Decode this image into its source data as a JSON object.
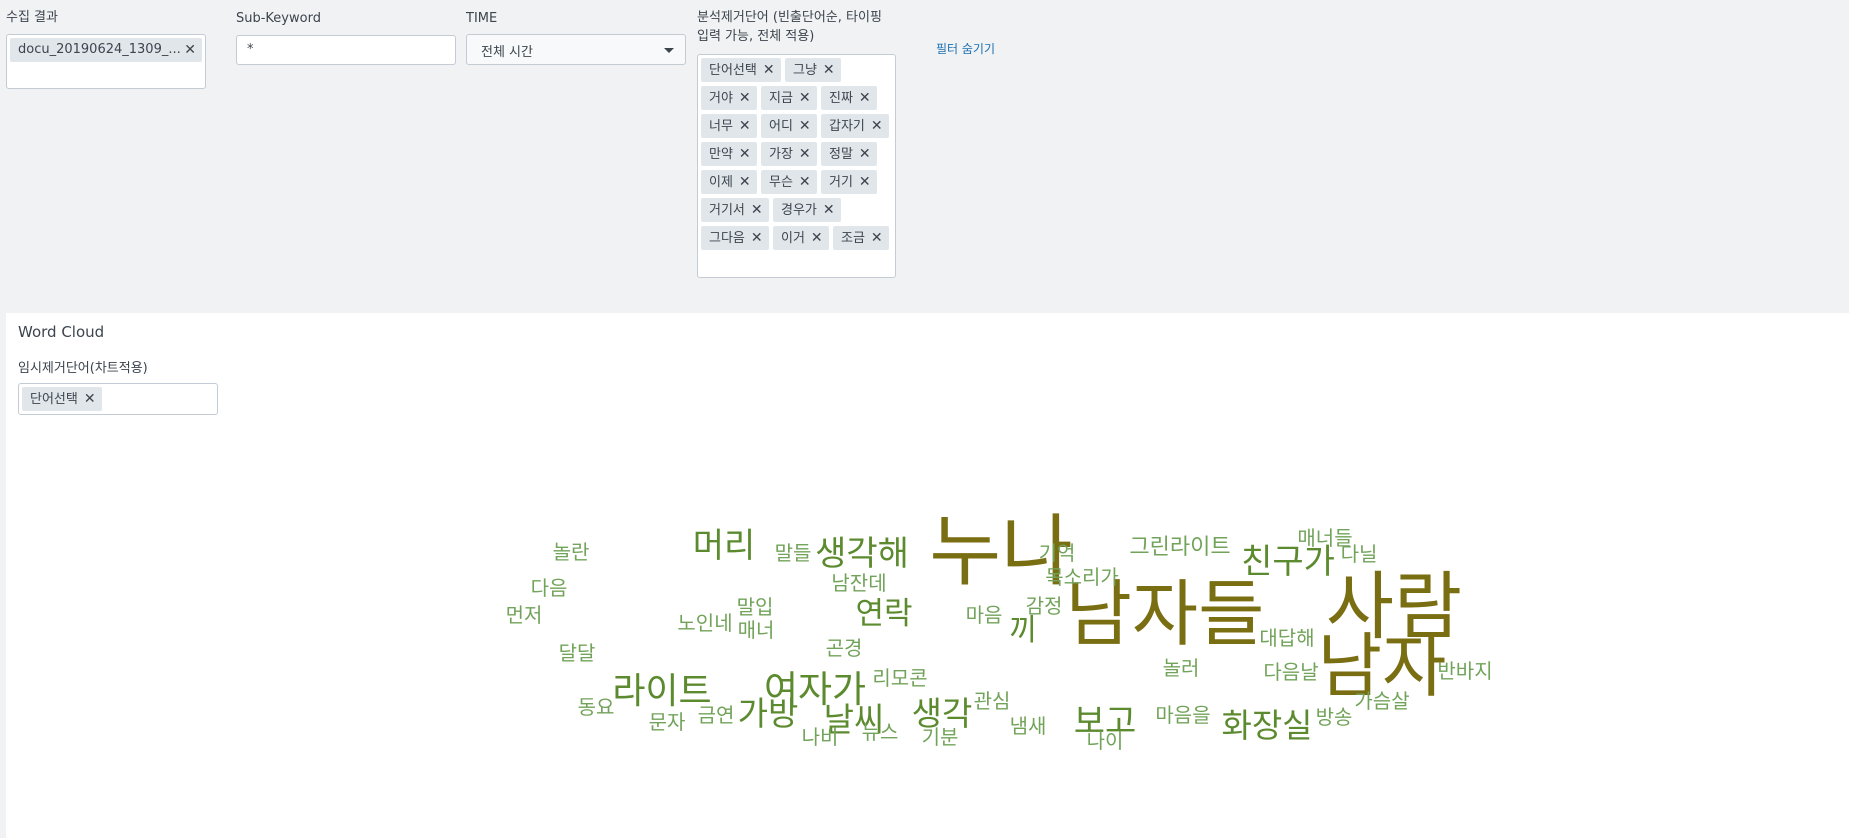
{
  "filters": {
    "collection": {
      "label": "수집 결과",
      "selected_chip": "docu_20190624_1309_..."
    },
    "subkeyword": {
      "label": "Sub-Keyword",
      "value": "*"
    },
    "time": {
      "label": "TIME",
      "value": "전체 시간"
    },
    "stopwords": {
      "label_line1": "분석제거단어 (빈출단어순, 타이핑",
      "label_line2": "입력 가능, 전체 적용)",
      "chips": [
        "단어선택",
        "그냥",
        "거야",
        "지금",
        "진짜",
        "너무",
        "어디",
        "갑자기",
        "만약",
        "가장",
        "정말",
        "이제",
        "무슨",
        "거기",
        "거기서",
        "경우가",
        "그다음",
        "이거",
        "조금"
      ]
    },
    "hide_filters_link": "필터 숨기기"
  },
  "panel": {
    "title": "Word Cloud",
    "temp_stopwords_label": "임시제거단어(차트적용)",
    "temp_chip": "단어선택"
  },
  "colors": {
    "large_word": "#7a6e12",
    "medium_word": "#5c8a2e",
    "small_word": "#72a35a"
  },
  "chart_data": {
    "type": "wordcloud",
    "words": [
      {
        "text": "누나",
        "weight": 100,
        "color": "#7a6e12"
      },
      {
        "text": "사람",
        "weight": 95,
        "color": "#7a6e12"
      },
      {
        "text": "남자들",
        "weight": 92,
        "color": "#7a6e12"
      },
      {
        "text": "남자",
        "weight": 90,
        "color": "#7a6e12"
      },
      {
        "text": "여자가",
        "weight": 48,
        "color": "#5c8a2e"
      },
      {
        "text": "라이트",
        "weight": 46,
        "color": "#5c8a2e"
      },
      {
        "text": "생각해",
        "weight": 44,
        "color": "#5c8a2e"
      },
      {
        "text": "머리",
        "weight": 44,
        "color": "#5c8a2e"
      },
      {
        "text": "친구가",
        "weight": 44,
        "color": "#5c8a2e"
      },
      {
        "text": "보고",
        "weight": 44,
        "color": "#5c8a2e"
      },
      {
        "text": "가방",
        "weight": 42,
        "color": "#5c8a2e"
      },
      {
        "text": "날씨",
        "weight": 42,
        "color": "#5c8a2e"
      },
      {
        "text": "생각",
        "weight": 42,
        "color": "#5c8a2e"
      },
      {
        "text": "화장실",
        "weight": 42,
        "color": "#5c8a2e"
      },
      {
        "text": "연락",
        "weight": 40,
        "color": "#5c8a2e"
      },
      {
        "text": "끼",
        "weight": 38,
        "color": "#5c8a2e"
      },
      {
        "text": "그린라이트",
        "weight": 28,
        "color": "#72a35a"
      },
      {
        "text": "매너들",
        "weight": 26,
        "color": "#72a35a"
      },
      {
        "text": "다닐",
        "weight": 26,
        "color": "#72a35a"
      },
      {
        "text": "기억",
        "weight": 26,
        "color": "#72a35a"
      },
      {
        "text": "목소리가",
        "weight": 26,
        "color": "#72a35a"
      },
      {
        "text": "감정",
        "weight": 26,
        "color": "#72a35a"
      },
      {
        "text": "마음",
        "weight": 26,
        "color": "#72a35a"
      },
      {
        "text": "남잔데",
        "weight": 26,
        "color": "#72a35a"
      },
      {
        "text": "말들",
        "weight": 26,
        "color": "#72a35a"
      },
      {
        "text": "말입",
        "weight": 26,
        "color": "#72a35a"
      },
      {
        "text": "노인네",
        "weight": 26,
        "color": "#72a35a"
      },
      {
        "text": "매너",
        "weight": 26,
        "color": "#72a35a"
      },
      {
        "text": "놀란",
        "weight": 26,
        "color": "#72a35a"
      },
      {
        "text": "다음",
        "weight": 26,
        "color": "#72a35a"
      },
      {
        "text": "먼저",
        "weight": 26,
        "color": "#72a35a"
      },
      {
        "text": "달달",
        "weight": 26,
        "color": "#72a35a"
      },
      {
        "text": "곤경",
        "weight": 26,
        "color": "#72a35a"
      },
      {
        "text": "리모콘",
        "weight": 26,
        "color": "#72a35a"
      },
      {
        "text": "관심",
        "weight": 26,
        "color": "#72a35a"
      },
      {
        "text": "냄새",
        "weight": 26,
        "color": "#72a35a"
      },
      {
        "text": "뉴스",
        "weight": 26,
        "color": "#72a35a"
      },
      {
        "text": "나비",
        "weight": 26,
        "color": "#72a35a"
      },
      {
        "text": "기분",
        "weight": 26,
        "color": "#72a35a"
      },
      {
        "text": "나이",
        "weight": 26,
        "color": "#72a35a"
      },
      {
        "text": "동요",
        "weight": 26,
        "color": "#72a35a"
      },
      {
        "text": "문자",
        "weight": 26,
        "color": "#72a35a"
      },
      {
        "text": "금연",
        "weight": 26,
        "color": "#72a35a"
      },
      {
        "text": "놀러",
        "weight": 26,
        "color": "#72a35a"
      },
      {
        "text": "대답해",
        "weight": 26,
        "color": "#72a35a"
      },
      {
        "text": "다음날",
        "weight": 26,
        "color": "#72a35a"
      },
      {
        "text": "반바지",
        "weight": 26,
        "color": "#72a35a"
      },
      {
        "text": "가슴살",
        "weight": 26,
        "color": "#72a35a"
      },
      {
        "text": "방송",
        "weight": 26,
        "color": "#72a35a"
      },
      {
        "text": "마음을",
        "weight": 26,
        "color": "#72a35a"
      }
    ]
  }
}
